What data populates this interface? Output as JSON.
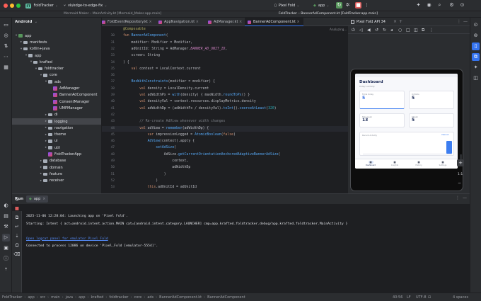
{
  "titlebar": {
    "project_badge": "FT",
    "project_name": "FoldTracker",
    "branch": "vk/edge-to-edge-fix",
    "device": "Pixel Fold",
    "run_config": "app",
    "window_title": "FoldTracker – BannerAdComponent.kt [FoldTracker.app.main]",
    "other_window_title": "Mermaid Maker – MainActivity.kt [Mermaid_Maker.app.main]"
  },
  "project_panel": {
    "title": "Android",
    "items": [
      {
        "label": "app",
        "depth": 0,
        "type": "module",
        "expanded": true
      },
      {
        "label": "manifests",
        "depth": 1,
        "type": "folder",
        "expanded": false
      },
      {
        "label": "kotlin+java",
        "depth": 1,
        "type": "folder",
        "expanded": true
      },
      {
        "label": "app",
        "depth": 2,
        "type": "folder",
        "expanded": true
      },
      {
        "label": "krafted",
        "depth": 3,
        "type": "folder",
        "expanded": true
      },
      {
        "label": "foldtracker",
        "depth": 4,
        "type": "folder",
        "expanded": true
      },
      {
        "label": "core",
        "depth": 5,
        "type": "folder",
        "expanded": true
      },
      {
        "label": "ads",
        "depth": 6,
        "type": "folder",
        "expanded": true
      },
      {
        "label": "AdManager",
        "depth": 7,
        "type": "file"
      },
      {
        "label": "BannerAdComponent",
        "depth": 7,
        "type": "file"
      },
      {
        "label": "ConsentManager",
        "depth": 7,
        "type": "file"
      },
      {
        "label": "UMPManager",
        "depth": 7,
        "type": "file"
      },
      {
        "label": "di",
        "depth": 6,
        "type": "folder",
        "expanded": false
      },
      {
        "label": "logging",
        "depth": 6,
        "type": "folder",
        "expanded": false,
        "selected": true
      },
      {
        "label": "navigation",
        "depth": 6,
        "type": "folder",
        "expanded": false
      },
      {
        "label": "theme",
        "depth": 6,
        "type": "folder",
        "expanded": false
      },
      {
        "label": "ui",
        "depth": 6,
        "type": "folder",
        "expanded": false
      },
      {
        "label": "util",
        "depth": 6,
        "type": "folder",
        "expanded": false
      },
      {
        "label": "FoldTrackerApp",
        "depth": 6,
        "type": "file"
      },
      {
        "label": "database",
        "depth": 5,
        "type": "folder",
        "expanded": false
      },
      {
        "label": "domain",
        "depth": 5,
        "type": "folder",
        "expanded": false
      },
      {
        "label": "feature",
        "depth": 5,
        "type": "folder",
        "expanded": false
      },
      {
        "label": "receiver",
        "depth": 5,
        "type": "folder",
        "expanded": false
      }
    ]
  },
  "editor": {
    "tabs": [
      {
        "label": "FoldEventRepository.kt",
        "active": false
      },
      {
        "label": "AppNavigation.kt",
        "active": false
      },
      {
        "label": "AdManager.kt",
        "active": false
      },
      {
        "label": "BannerAdComponent.kt",
        "active": true
      }
    ],
    "analyzing": "Analyzing...",
    "lines": [
      {
        "n": "",
        "text": "@Composable"
      },
      {
        "n": "30",
        "text": "fun BannerAdComponent("
      },
      {
        "n": "31",
        "text": "    modifier: Modifier = Modifier,"
      },
      {
        "n": "32",
        "text": "    adUnitId: String = AdManager.BANNER_AD_UNIT_ID,"
      },
      {
        "n": "33",
        "text": "    screen: String"
      },
      {
        "n": "34",
        "text": ") {"
      },
      {
        "n": "35",
        "text": "    val context = LocalContext.current"
      },
      {
        "n": "36",
        "text": ""
      },
      {
        "n": "37",
        "text": "    BoxWithConstraints(modifier = modifier) {"
      },
      {
        "n": "38",
        "text": "        val density = LocalDensity.current"
      },
      {
        "n": "39",
        "text": "        val adWidthPx = with(density) { maxWidth.roundToPx() }"
      },
      {
        "n": "40",
        "text": "        val densityVal = context.resources.displayMetrics.density"
      },
      {
        "n": "41",
        "text": "        val adWidthDp = (adWidthPx / densityVal).toInt().coerceAtLeast(320)"
      },
      {
        "n": "42",
        "text": ""
      },
      {
        "n": "43",
        "text": "        // Re-create AdView whenever width changes"
      },
      {
        "n": "44",
        "text": "        val adView = remember(adWidthDp) {"
      },
      {
        "n": "45",
        "text": "            var impressionLogged = AtomicBoolean(false)"
      },
      {
        "n": "46",
        "text": "            AdView(context).apply {"
      },
      {
        "n": "47",
        "text": "                setAdSize("
      },
      {
        "n": "48",
        "text": "                    AdSize.getCurrentOrientationAnchoredAdaptiveBannerAdSize("
      },
      {
        "n": "49",
        "text": "                        context,"
      },
      {
        "n": "50",
        "text": "                        adWidthDp"
      },
      {
        "n": "51",
        "text": "                    )"
      },
      {
        "n": "52",
        "text": "                )"
      },
      {
        "n": "53",
        "text": "            this.adUnitId = adUnitId"
      }
    ]
  },
  "emulator": {
    "title": "Pixel Fold API 34",
    "app": {
      "title": "Dashboard",
      "subtitle": "Today's Activity",
      "card1_label": "Folds today",
      "card1_value": "5",
      "card2_label": "Unfolds",
      "card2_value": "5",
      "card3_label": "This week",
      "card3_value": "13",
      "card4_label": "Streak",
      "card4_value": "5",
      "chart_label": "Recent Activity",
      "chart_link": "View All",
      "nav": [
        "Dashboard",
        "Insights",
        "History",
        "Settings"
      ]
    },
    "zoom_label": "1:1"
  },
  "run": {
    "title": "Run",
    "config_tab": "app",
    "console": [
      {
        "text": "2025-11-06 12:28:04: Launching app on 'Pixel Fold'.",
        "kind": "normal"
      },
      {
        "text": "Starting: Intent { act=android.intent.action.MAIN cat=[android.intent.category.LAUNCHER] cmp=app.krafted.foldtracker.debug/app.krafted.foldtracker.MainActivity }",
        "kind": "normal"
      },
      {
        "text": "",
        "kind": "normal"
      },
      {
        "text": "Open logcat panel for emulator Pixel Fold",
        "kind": "link"
      },
      {
        "text": "Connected to process 12086 on device 'Pixel_Fold [emulator-5554]'.",
        "kind": "normal"
      }
    ]
  },
  "statusbar": {
    "breadcrumb": [
      "FoldTracker",
      "app",
      "src",
      "main",
      "java",
      "app",
      "krafted",
      "foldtracker",
      "core",
      "ads",
      "BannerAdComponent.kt",
      "BannerAdComponent"
    ],
    "position": "40:56",
    "line_sep": "LF",
    "encoding": "UTF-8",
    "indent": "4 spaces"
  },
  "colors": {
    "accent": "#3574f0",
    "run_green": "#57965c",
    "stop_red": "#db5c5c",
    "keyword": "#cf8e6d",
    "function": "#56a8f5",
    "constant": "#c77dbb",
    "number": "#2aacb8",
    "comment": "#7a7e85",
    "link": "#548af7"
  }
}
